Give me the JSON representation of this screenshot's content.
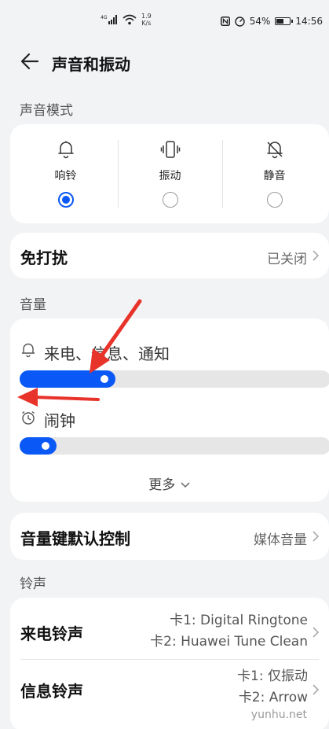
{
  "status_bar": {
    "network": "4G",
    "speed_value": "1.9",
    "speed_unit": "K/s",
    "battery": "54%",
    "time": "14:56"
  },
  "header": {
    "title": "声音和振动"
  },
  "sound_mode": {
    "section_label": "声音模式",
    "options": [
      {
        "label": "响铃",
        "icon": "bell-icon",
        "selected": true
      },
      {
        "label": "振动",
        "icon": "vibrate-icon",
        "selected": false
      },
      {
        "label": "静音",
        "icon": "bell-off-icon",
        "selected": false
      }
    ]
  },
  "dnd": {
    "title": "免打扰",
    "value": "已关闭"
  },
  "volume": {
    "section_label": "音量",
    "sliders": [
      {
        "label": "来电、信息、通知",
        "icon": "bell-icon",
        "level": 0.28
      },
      {
        "label": "闹钟",
        "icon": "alarm-clock-icon",
        "level": 0.09
      }
    ],
    "more_label": "更多"
  },
  "volume_key": {
    "title": "音量键默认控制",
    "value": "媒体音量"
  },
  "ringtone": {
    "section_label": "铃声",
    "rows": [
      {
        "title": "来电铃声",
        "value_1": "卡1: Digital Ringtone",
        "value_2": "卡2: Huawei Tune Clean"
      },
      {
        "title": "信息铃声",
        "value_1": "卡1: 仅振动",
        "value_2": "卡2: Arrow"
      }
    ]
  },
  "annotation_color": "#e8332a",
  "accent_color": "#0a59f7",
  "watermark": "yunhu.net"
}
